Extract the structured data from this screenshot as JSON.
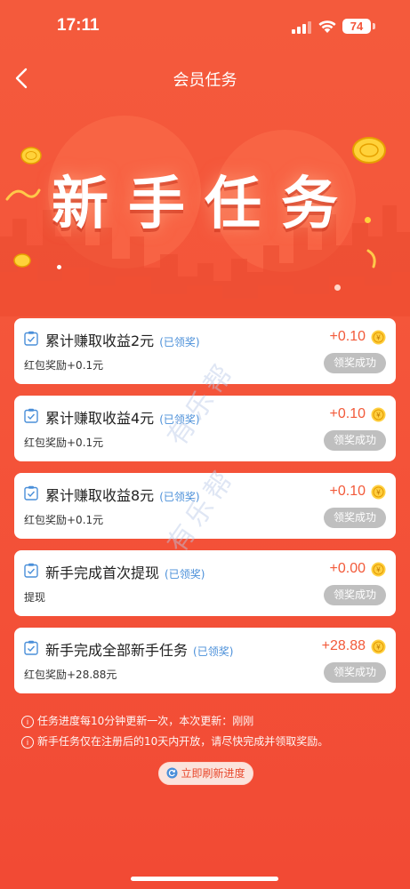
{
  "status_bar": {
    "time": "17:11",
    "battery": "74"
  },
  "nav": {
    "title": "会员任务"
  },
  "banner": {
    "title": "新手任务"
  },
  "tasks": [
    {
      "title": "累计赚取收益2元",
      "status": "(已领奖)",
      "reward": "+0.10",
      "desc": "红包奖励+0.1元",
      "button": "领奖成功"
    },
    {
      "title": "累计赚取收益4元",
      "status": "(已领奖)",
      "reward": "+0.10",
      "desc": "红包奖励+0.1元",
      "button": "领奖成功"
    },
    {
      "title": "累计赚取收益8元",
      "status": "(已领奖)",
      "reward": "+0.10",
      "desc": "红包奖励+0.1元",
      "button": "领奖成功"
    },
    {
      "title": "新手完成首次提现",
      "status": "(已领奖)",
      "reward": "+0.00",
      "desc": "提现",
      "button": "领奖成功"
    },
    {
      "title": "新手完成全部新手任务",
      "status": "(已领奖)",
      "reward": "+28.88",
      "desc": "红包奖励+28.88元",
      "button": "领奖成功"
    }
  ],
  "notes": [
    "任务进度每10分钟更新一次，本次更新：刚刚",
    "新手任务仅在注册后的10天内开放，请尽快完成并领取奖励。"
  ],
  "refresh": {
    "label": "立即刷新进度"
  },
  "watermark": "有乐帮",
  "colors": {
    "background": "#f4553a",
    "accent": "#f25a3a",
    "status_blue": "#4a8fd9",
    "button_gray": "#bfbfbf"
  }
}
